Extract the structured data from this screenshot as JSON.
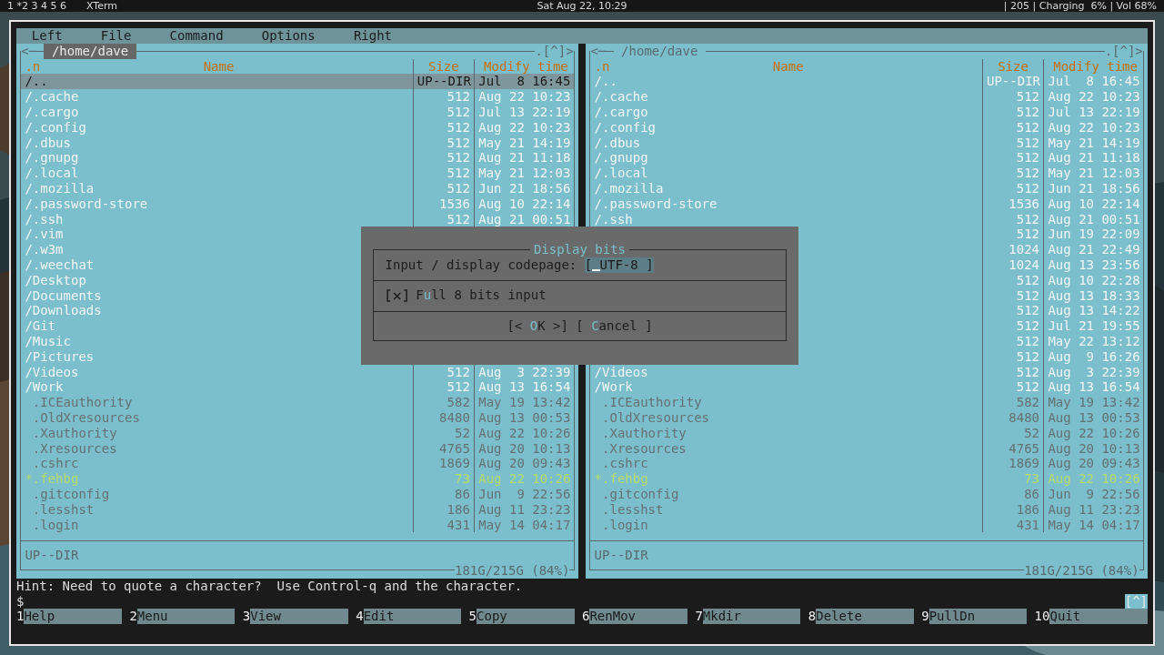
{
  "top_bar": {
    "workspaces": "1 *2 3 4 5 6",
    "app": "XTerm",
    "clock": "Sat Aug 22, 10:29",
    "status": "| 205 | Charging  6% | Vol 68%"
  },
  "menu": [
    "Left",
    "File",
    "Command",
    "Options",
    "Right"
  ],
  "panels": [
    {
      "active": true,
      "nav_left": "<─",
      "path": "/home/dave",
      "nav_right": ".[^]>",
      "columns": [
        ".n",
        "Name",
        "Size",
        "Modify time"
      ],
      "rows": [
        {
          "kind": "dir",
          "name": "/..",
          "size": "UP--DIR",
          "time": "Jul  8 16:45",
          "selected": true
        },
        {
          "kind": "dir",
          "name": "/.cache",
          "size": "512",
          "time": "Aug 22 10:23",
          "selected": false
        },
        {
          "kind": "dir",
          "name": "/.cargo",
          "size": "512",
          "time": "Jul 13 22:19",
          "selected": false
        },
        {
          "kind": "dir",
          "name": "/.config",
          "size": "512",
          "time": "Aug 22 10:23",
          "selected": false
        },
        {
          "kind": "dir",
          "name": "/.dbus",
          "size": "512",
          "time": "May 21 14:19",
          "selected": false
        },
        {
          "kind": "dir",
          "name": "/.gnupg",
          "size": "512",
          "time": "Aug 21 11:18",
          "selected": false
        },
        {
          "kind": "dir",
          "name": "/.local",
          "size": "512",
          "time": "May 21 12:03",
          "selected": false
        },
        {
          "kind": "dir",
          "name": "/.mozilla",
          "size": "512",
          "time": "Jun 21 18:56",
          "selected": false
        },
        {
          "kind": "dir",
          "name": "/.password-store",
          "size": "1536",
          "time": "Aug 10 22:14",
          "selected": false
        },
        {
          "kind": "dir",
          "name": "/.ssh",
          "size": "512",
          "time": "Aug 21 00:51",
          "selected": false
        },
        {
          "kind": "dir",
          "name": "/.vim",
          "selected": false
        },
        {
          "kind": "dir",
          "name": "/.w3m",
          "selected": false
        },
        {
          "kind": "dir",
          "name": "/.weechat",
          "selected": false
        },
        {
          "kind": "dir",
          "name": "/Desktop",
          "selected": false
        },
        {
          "kind": "dir",
          "name": "/Documents",
          "selected": false
        },
        {
          "kind": "dir",
          "name": "/Downloads",
          "selected": false
        },
        {
          "kind": "dir",
          "name": "/Git",
          "selected": false
        },
        {
          "kind": "dir",
          "name": "/Music",
          "selected": false
        },
        {
          "kind": "dir",
          "name": "/Pictures",
          "selected": false
        },
        {
          "kind": "dir",
          "name": "/Videos",
          "size": "512",
          "time": "Aug  3 22:39",
          "selected": false
        },
        {
          "kind": "dir",
          "name": "/Work",
          "size": "512",
          "time": "Aug 13 16:54",
          "selected": false
        },
        {
          "kind": "file",
          "name": ".ICEauthority",
          "size": "582",
          "time": "May 19 13:42",
          "selected": false
        },
        {
          "kind": "file",
          "name": ".OldXresources",
          "size": "8480",
          "time": "Aug 13 00:53",
          "selected": false
        },
        {
          "kind": "file",
          "name": ".Xauthority",
          "size": "52",
          "time": "Aug 22 10:26",
          "selected": false
        },
        {
          "kind": "file",
          "name": ".Xresources",
          "size": "4765",
          "time": "Aug 20 10:13",
          "selected": false
        },
        {
          "kind": "file",
          "name": ".cshrc",
          "size": "1869",
          "time": "Aug 20 09:43",
          "selected": false
        },
        {
          "kind": "exec",
          "name": "*.fehbg",
          "size": "73",
          "time": "Aug 22 10:26",
          "selected": false
        },
        {
          "kind": "file",
          "name": ".gitconfig",
          "size": "86",
          "time": "Jun  9 22:56",
          "selected": false
        },
        {
          "kind": "file",
          "name": ".lesshst",
          "size": "186",
          "time": "Aug 11 23:23",
          "selected": false
        },
        {
          "kind": "file",
          "name": ".login",
          "size": "431",
          "time": "May 14 04:17",
          "selected": false
        }
      ],
      "info": "UP--DIR",
      "disk": "181G/215G (84%)"
    },
    {
      "active": false,
      "nav_left": "<─",
      "path": "/home/dave",
      "nav_right": ".[^]>",
      "columns": [
        ".n",
        "Name",
        "Size",
        "Modify time"
      ],
      "rows": [
        {
          "kind": "dir",
          "name": "/..",
          "size": "UP--DIR",
          "time": "Jul  8 16:45",
          "selected": false
        },
        {
          "kind": "dir",
          "name": "/.cache",
          "size": "512",
          "time": "Aug 22 10:23",
          "selected": false
        },
        {
          "kind": "dir",
          "name": "/.cargo",
          "size": "512",
          "time": "Jul 13 22:19",
          "selected": false
        },
        {
          "kind": "dir",
          "name": "/.config",
          "size": "512",
          "time": "Aug 22 10:23",
          "selected": false
        },
        {
          "kind": "dir",
          "name": "/.dbus",
          "size": "512",
          "time": "May 21 14:19",
          "selected": false
        },
        {
          "kind": "dir",
          "name": "/.gnupg",
          "size": "512",
          "time": "Aug 21 11:18",
          "selected": false
        },
        {
          "kind": "dir",
          "name": "/.local",
          "size": "512",
          "time": "May 21 12:03",
          "selected": false
        },
        {
          "kind": "dir",
          "name": "/.mozilla",
          "size": "512",
          "time": "Jun 21 18:56",
          "selected": false
        },
        {
          "kind": "dir",
          "name": "/.password-store",
          "size": "1536",
          "time": "Aug 10 22:14",
          "selected": false
        },
        {
          "kind": "dir",
          "name": "/.ssh",
          "size": "512",
          "time": "Aug 21 00:51",
          "selected": false
        },
        {
          "kind": "dir",
          "size": "512",
          "time": "Jun 19 22:09",
          "selected": false
        },
        {
          "kind": "dir",
          "size": "1024",
          "time": "Aug 21 22:49",
          "selected": false
        },
        {
          "kind": "dir",
          "size": "1024",
          "time": "Aug 13 23:56",
          "selected": false
        },
        {
          "kind": "dir",
          "size": "512",
          "time": "Aug 10 22:28",
          "selected": false
        },
        {
          "kind": "dir",
          "size": "512",
          "time": "Aug 13 18:33",
          "selected": false
        },
        {
          "kind": "dir",
          "size": "512",
          "time": "Aug 13 14:22",
          "selected": false
        },
        {
          "kind": "dir",
          "size": "512",
          "time": "Jul 21 19:55",
          "selected": false
        },
        {
          "kind": "dir",
          "size": "512",
          "time": "May 22 13:12",
          "selected": false
        },
        {
          "kind": "dir",
          "size": "512",
          "time": "Aug  9 16:26",
          "selected": false
        },
        {
          "kind": "dir",
          "name": "/Videos",
          "size": "512",
          "time": "Aug  3 22:39",
          "selected": false
        },
        {
          "kind": "dir",
          "name": "/Work",
          "size": "512",
          "time": "Aug 13 16:54",
          "selected": false
        },
        {
          "kind": "file",
          "name": ".ICEauthority",
          "size": "582",
          "time": "May 19 13:42",
          "selected": false
        },
        {
          "kind": "file",
          "name": ".OldXresources",
          "size": "8480",
          "time": "Aug 13 00:53",
          "selected": false
        },
        {
          "kind": "file",
          "name": ".Xauthority",
          "size": "52",
          "time": "Aug 22 10:26",
          "selected": false
        },
        {
          "kind": "file",
          "name": ".Xresources",
          "size": "4765",
          "time": "Aug 20 10:13",
          "selected": false
        },
        {
          "kind": "file",
          "name": ".cshrc",
          "size": "1869",
          "time": "Aug 20 09:43",
          "selected": false
        },
        {
          "kind": "exec",
          "name": "*.fehbg",
          "size": "73",
          "time": "Aug 22 10:26",
          "selected": false
        },
        {
          "kind": "file",
          "name": ".gitconfig",
          "size": "86",
          "time": "Jun  9 22:56",
          "selected": false
        },
        {
          "kind": "file",
          "name": ".lesshst",
          "size": "186",
          "time": "Aug 11 23:23",
          "selected": false
        },
        {
          "kind": "file",
          "name": ".login",
          "size": "431",
          "time": "May 14 04:17",
          "selected": false
        }
      ],
      "info": "UP--DIR",
      "disk": "181G/215G (84%)"
    }
  ],
  "hint": "Hint: Need to quote a character?  Use Control-q and the character.",
  "prompt": "$",
  "scroll_marker": "[^]",
  "function_keys": [
    {
      "key": "1",
      "label": "Help"
    },
    {
      "key": "2",
      "label": "Menu"
    },
    {
      "key": "3",
      "label": "View"
    },
    {
      "key": "4",
      "label": "Edit"
    },
    {
      "key": "5",
      "label": "Copy"
    },
    {
      "key": "6",
      "label": "RenMov"
    },
    {
      "key": "7",
      "label": "Mkdir"
    },
    {
      "key": "8",
      "label": "Delete"
    },
    {
      "key": "9",
      "label": "PullDn"
    },
    {
      "key": "10",
      "label": "Quit"
    }
  ],
  "dialog": {
    "title": "Display bits",
    "field_label": "Input / display codepage:",
    "field_value": "[ UTF-8 ]",
    "checkbox": {
      "checked": true,
      "before": "F",
      "hotkey": "u",
      "after": "ll 8 bits input"
    },
    "buttons": [
      {
        "before": "[< ",
        "hotkey": "O",
        "after": "K >]"
      },
      {
        "before": "[ ",
        "hotkey": "C",
        "after": "ancel ]"
      }
    ]
  }
}
